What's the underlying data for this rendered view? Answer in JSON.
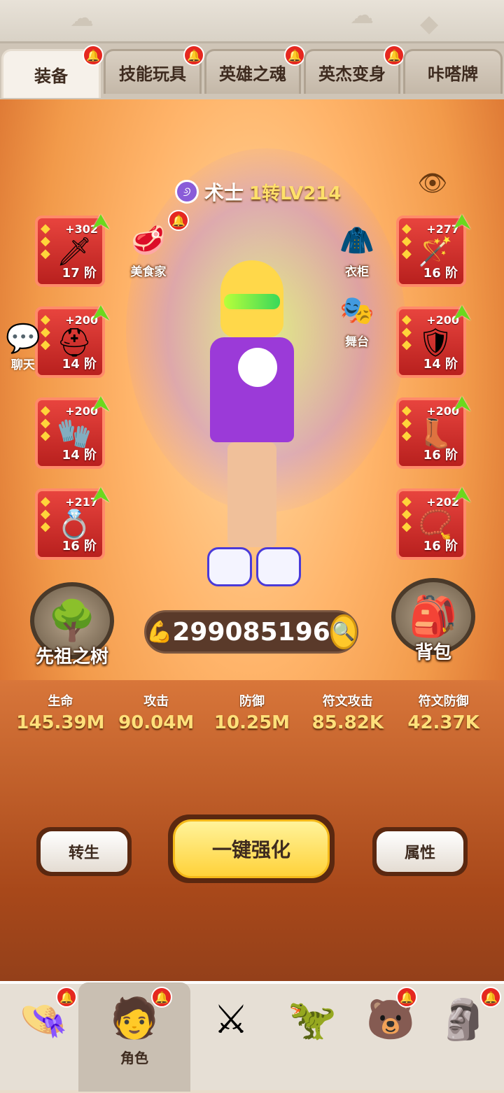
{
  "tabs": [
    {
      "label": "装备",
      "active": true
    },
    {
      "label": "技能玩具"
    },
    {
      "label": "英雄之魂"
    },
    {
      "label": "英杰变身"
    },
    {
      "label": "咔嗒牌"
    }
  ],
  "character": {
    "class_name": "术士",
    "level_text": "1转LV214"
  },
  "shortcuts": {
    "gourmet": "美食家",
    "wardrobe": "衣柜",
    "stage": "舞台",
    "chat": "聊天"
  },
  "equipment_left": [
    {
      "plus": "+302",
      "tier": "17 阶",
      "icon": "staff-icon"
    },
    {
      "plus": "+200",
      "tier": "14 阶",
      "icon": "helmet-icon"
    },
    {
      "plus": "+200",
      "tier": "14 阶",
      "icon": "glove-icon"
    },
    {
      "plus": "+217",
      "tier": "16 阶",
      "icon": "ring-icon"
    }
  ],
  "equipment_right": [
    {
      "plus": "+277",
      "tier": "16 阶",
      "icon": "wand-icon"
    },
    {
      "plus": "+200",
      "tier": "14 阶",
      "icon": "armor-icon"
    },
    {
      "plus": "+200",
      "tier": "16 阶",
      "icon": "boots-icon"
    },
    {
      "plus": "+202",
      "tier": "16 阶",
      "icon": "necklace-icon"
    }
  ],
  "ancestor_tree_label": "先祖之树",
  "backpack_label": "背包",
  "power_value": "299085196",
  "stats": [
    {
      "label": "生命",
      "value": "145.39M"
    },
    {
      "label": "攻击",
      "value": "90.04M"
    },
    {
      "label": "防御",
      "value": "10.25M"
    },
    {
      "label": "符文攻击",
      "value": "85.82K"
    },
    {
      "label": "符文防御",
      "value": "42.37K"
    }
  ],
  "buttons": {
    "rebirth": "转生",
    "one_click_enhance": "一键强化",
    "attributes": "属性"
  },
  "bottom_nav": [
    {
      "label": "",
      "icon": "straw-hat-icon"
    },
    {
      "label": "角色",
      "icon": "character-icon",
      "active": true
    },
    {
      "label": "",
      "icon": "sword-shield-icon"
    },
    {
      "label": "",
      "icon": "dino-icon"
    },
    {
      "label": "",
      "icon": "bear-icon"
    },
    {
      "label": "",
      "icon": "totem-icon"
    }
  ],
  "colors": {
    "accent_gold": "#ffe07a",
    "slot_red": "#d8302a",
    "notification_red": "#e52820",
    "upgrade_green": "#6bd81e"
  }
}
